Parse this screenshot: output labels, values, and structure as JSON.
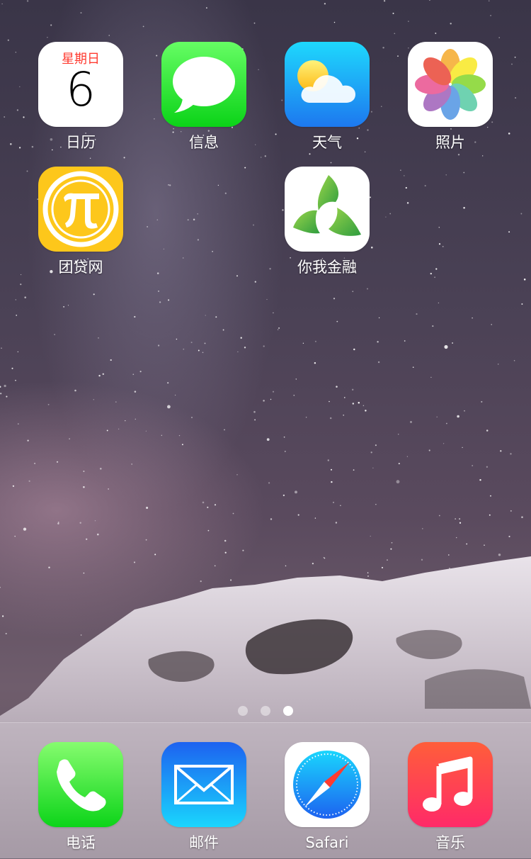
{
  "home": {
    "apps": [
      {
        "label": "日历",
        "icon": "calendar-icon",
        "weekday": "星期日",
        "day": "6"
      },
      {
        "label": "信息",
        "icon": "messages-icon"
      },
      {
        "label": "天气",
        "icon": "weather-icon"
      },
      {
        "label": "照片",
        "icon": "photos-icon"
      },
      {
        "label": "团贷网",
        "icon": "tuandai-pi-icon"
      },
      {
        "label": "你我金融",
        "icon": "niwo-finance-icon"
      }
    ]
  },
  "pager": {
    "pages": 3,
    "active_page": 3
  },
  "dock": {
    "apps": [
      {
        "label": "电话",
        "icon": "phone-icon"
      },
      {
        "label": "邮件",
        "icon": "mail-icon"
      },
      {
        "label": "Safari",
        "icon": "safari-compass-icon"
      },
      {
        "label": "音乐",
        "icon": "music-note-icon"
      }
    ]
  },
  "colors": {
    "calendar_red": "#ff3b30",
    "messages_green": "#0bd318",
    "weather_blue": "#1d78ef",
    "tuandai_yellow": "#fdc71b",
    "music_red": "#ff2a68"
  }
}
